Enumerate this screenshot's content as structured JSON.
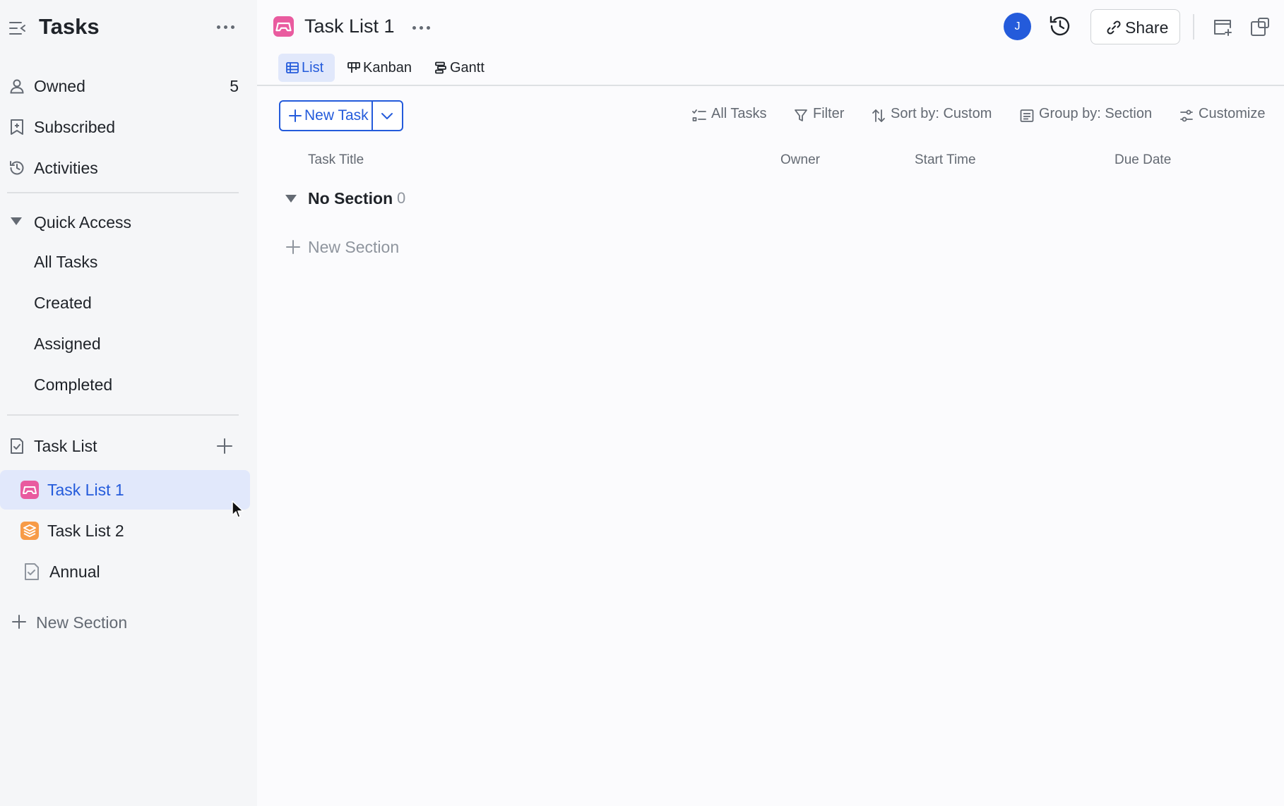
{
  "sidebar": {
    "title": "Tasks",
    "nav": [
      {
        "label": "Owned",
        "count": "5"
      },
      {
        "label": "Subscribed"
      },
      {
        "label": "Activities"
      }
    ],
    "quick_access": {
      "label": "Quick Access",
      "items": [
        "All Tasks",
        "Created",
        "Assigned",
        "Completed"
      ]
    },
    "task_list": {
      "label": "Task List",
      "items": [
        {
          "label": "Task List 1",
          "active": true,
          "icon": "pink-gamepad-icon"
        },
        {
          "label": "Task List 2",
          "icon": "orange-layers-icon"
        },
        {
          "label": "Annual",
          "icon": "task-list-icon"
        }
      ]
    },
    "new_section": "New Section"
  },
  "header": {
    "title": "Task List 1",
    "avatar_initial": "J",
    "share_label": "Share"
  },
  "tabs": [
    "List",
    "Kanban",
    "Gantt"
  ],
  "toolbar": {
    "new_task": "New Task",
    "all_tasks": "All Tasks",
    "filter": "Filter",
    "sort": "Sort by: Custom",
    "group": "Group by: Section",
    "customize": "Customize"
  },
  "columns": [
    "Task Title",
    "Owner",
    "Start Time",
    "Due Date"
  ],
  "section": {
    "title": "No Section",
    "count": "0"
  },
  "main_new_section": "New Section",
  "colors": {
    "accent": "#245bdb",
    "active_bg": "#e1e8fb",
    "sidebar_bg": "#f5f6f8",
    "task_list_1_icon": "#e95b9f",
    "task_list_2_icon": "#f79b47"
  }
}
